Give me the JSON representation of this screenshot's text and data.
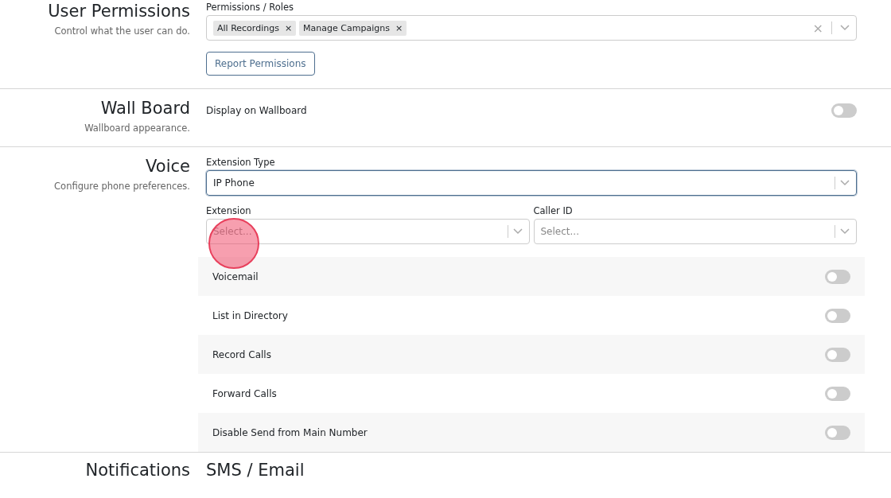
{
  "sections": [
    {
      "title": "User Permissions",
      "description": "Control what the user can do.",
      "kind": "permissions",
      "field_label": "Permissions / Roles",
      "tags": [
        {
          "label": "All Recordings",
          "remove": "×"
        },
        {
          "label": "Manage Campaigns",
          "remove": "×"
        }
      ],
      "clear": "×",
      "button": "Report Permissions"
    },
    {
      "title": "Wall Board",
      "description": "Wallboard appearance.",
      "kind": "wallboard",
      "toggle": {
        "label": "Display on Wallboard",
        "on": false
      }
    },
    {
      "title": "Voice",
      "description": "Configure phone preferences.",
      "kind": "voice",
      "extension_type": {
        "label": "Extension Type",
        "value": "IP Phone",
        "focused": true
      },
      "selects": [
        {
          "label": "Extension",
          "placeholder": "Select..."
        },
        {
          "label": "Caller ID",
          "placeholder": "Select..."
        }
      ],
      "toggles": [
        {
          "label": "Voicemail",
          "on": false
        },
        {
          "label": "List in Directory",
          "on": false
        },
        {
          "label": "Record Calls",
          "on": false
        },
        {
          "label": "Forward Calls",
          "on": false
        },
        {
          "label": "Disable Send from Main Number",
          "on": false
        }
      ]
    },
    {
      "title": "Notifications",
      "kind": "notifications",
      "subtitle": "SMS / Email"
    }
  ]
}
